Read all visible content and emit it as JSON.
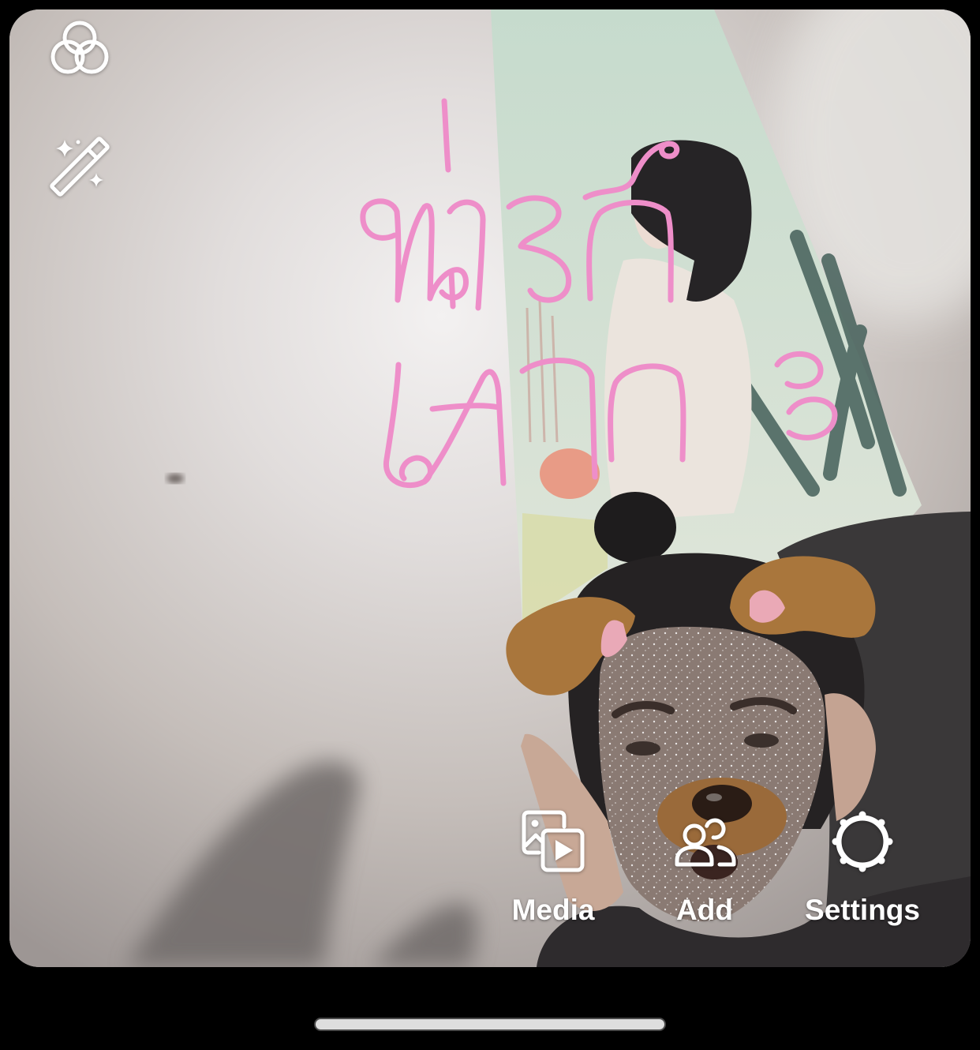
{
  "top_controls": [
    {
      "icon": "effects-icon"
    },
    {
      "icon": "magic-wand-icon"
    }
  ],
  "drawing": {
    "color": "#ee8ec9",
    "lines": [
      "น่ารัก",
      "มากะ"
    ]
  },
  "actions": [
    {
      "label": "Media",
      "icon": "media-icon"
    },
    {
      "label": "Add",
      "icon": "add-people-icon"
    },
    {
      "label": "Settings",
      "icon": "settings-icon"
    }
  ],
  "colors": {
    "background": "#000000",
    "icon": "#ffffff",
    "label": "#ffffff",
    "home_indicator": "#dedede"
  }
}
